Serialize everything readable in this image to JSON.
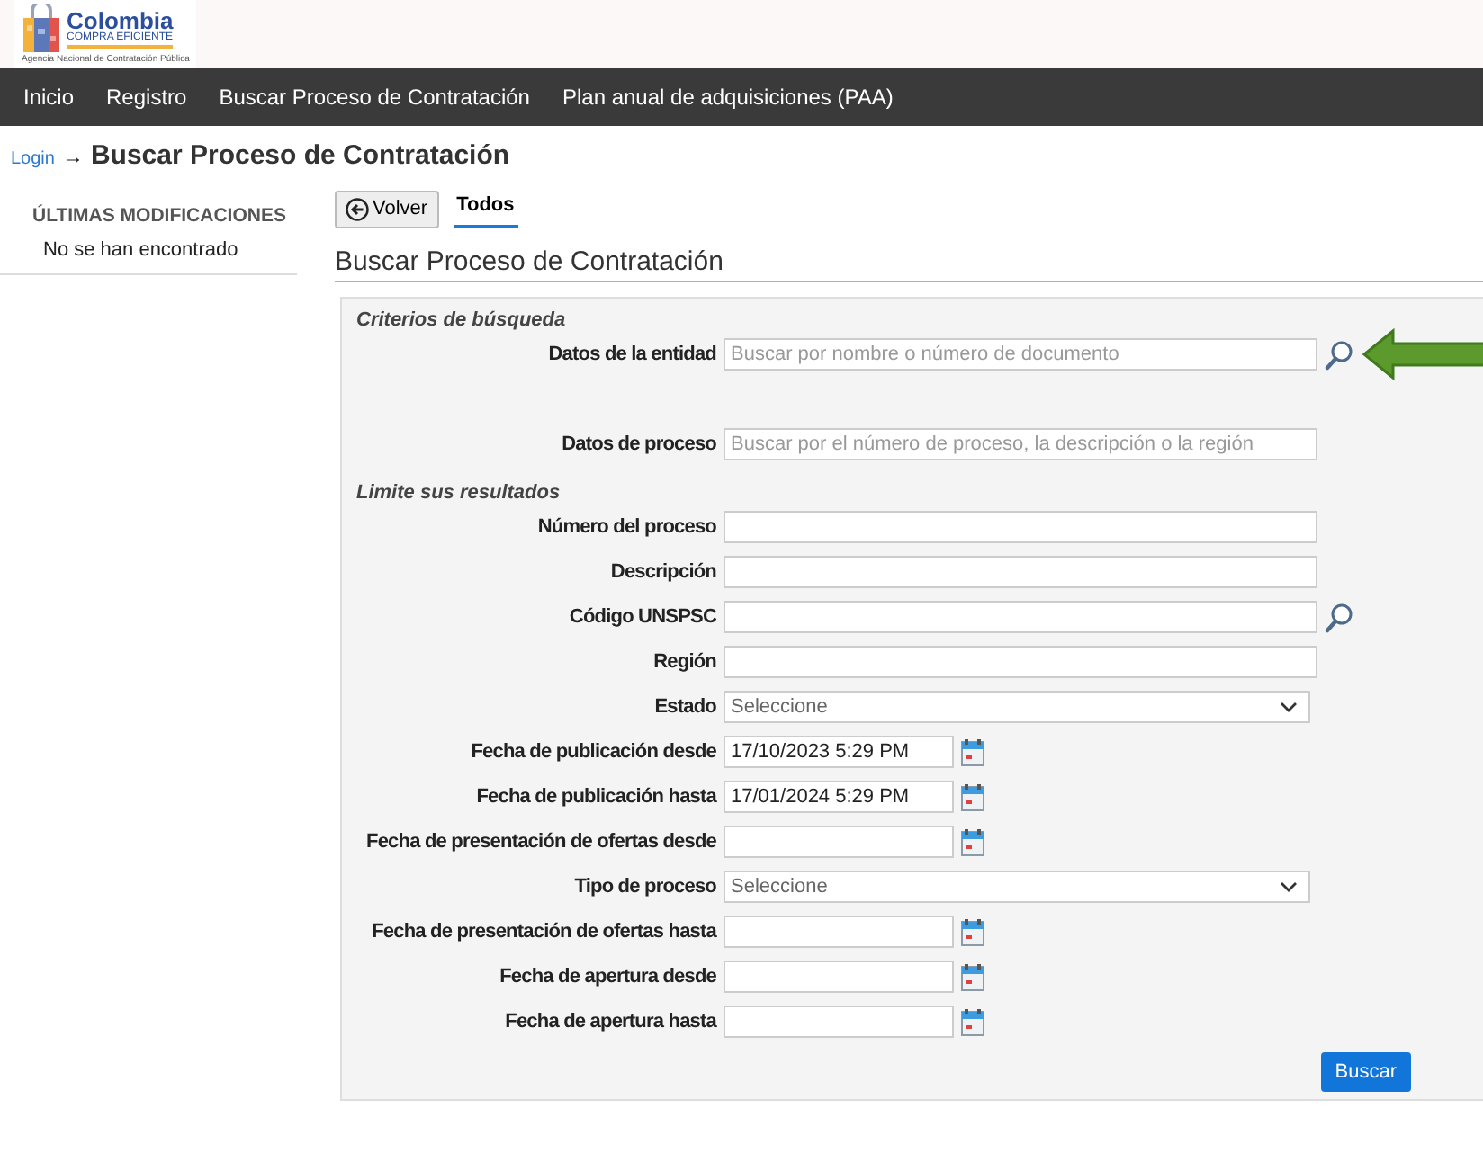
{
  "logo": {
    "name": "Colombia",
    "subtitle": "COMPRA EFICIENTE",
    "agency": "Agencia Nacional de Contratación Pública"
  },
  "nav": [
    "Inicio",
    "Registro",
    "Buscar Proceso de Contratación",
    "Plan anual de adquisiciones (PAA)"
  ],
  "breadcrumb": {
    "link": "Login",
    "separator": "→",
    "current": "Buscar Proceso de Contratación"
  },
  "sidebar": {
    "title": "ÚLTIMAS MODIFICACIONES",
    "empty": "No se han encontrado"
  },
  "back_button": "Volver",
  "tabs": [
    {
      "label": "Todos",
      "selected": true
    }
  ],
  "heading": "Buscar Proceso de Contratación",
  "sections": [
    {
      "title": "Criterios de búsqueda",
      "fields": [
        {
          "label": "Datos de la entidad",
          "kind": "search",
          "placeholder": "Buscar por nombre o número de documento"
        },
        {
          "label": "Datos de proceso",
          "kind": "text",
          "placeholder": "Buscar por el número de proceso, la descripción o la región"
        }
      ]
    },
    {
      "title": "Limite sus resultados",
      "fields": [
        {
          "label": "Número del proceso",
          "kind": "text"
        },
        {
          "label": "Descripción",
          "kind": "text"
        },
        {
          "label": "Código UNSPSC",
          "kind": "search"
        },
        {
          "label": "Región",
          "kind": "text"
        },
        {
          "label": "Estado",
          "kind": "select",
          "value": "Seleccione"
        },
        {
          "label": "Fecha de publicación desde",
          "kind": "date",
          "value": "17/10/2023 5:29 PM"
        },
        {
          "label": "Fecha de publicación hasta",
          "kind": "date",
          "value": "17/01/2024 5:29 PM"
        },
        {
          "label": "Fecha de presentación de ofertas desde",
          "kind": "date"
        },
        {
          "label": "Tipo de proceso",
          "kind": "select",
          "value": "Seleccione"
        },
        {
          "label": "Fecha de presentación de ofertas hasta",
          "kind": "date"
        },
        {
          "label": "Fecha de apertura desde",
          "kind": "date"
        },
        {
          "label": "Fecha de apertura hasta",
          "kind": "date"
        }
      ]
    }
  ],
  "submit": "Buscar",
  "annotation": {
    "kind": "arrow"
  }
}
